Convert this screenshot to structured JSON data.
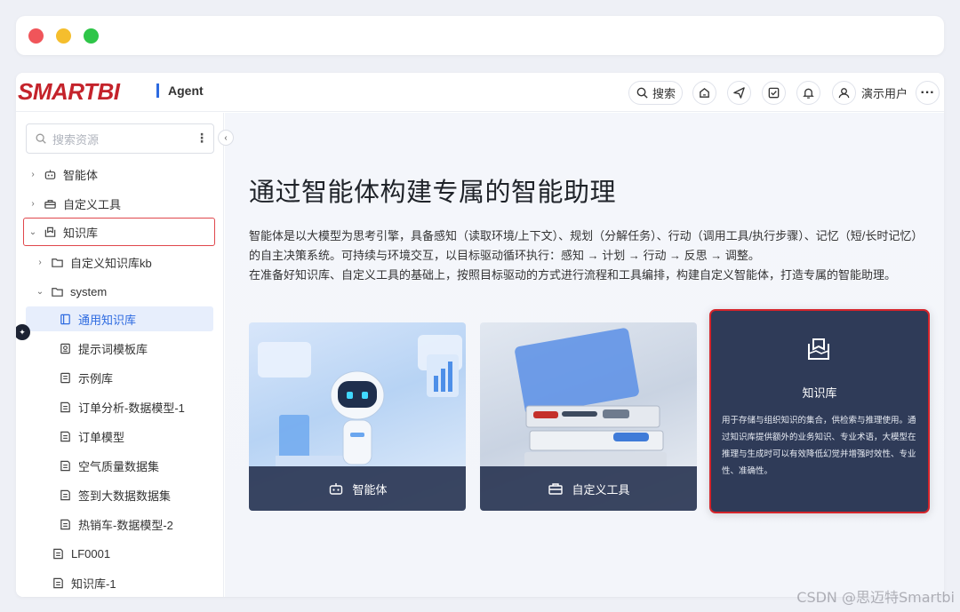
{
  "window_controls": [
    "close",
    "minimize",
    "maximize"
  ],
  "header": {
    "logo": "SMARTBI",
    "product": "Agent",
    "search_label": "搜索",
    "user_name": "演示用户",
    "more_label": "···"
  },
  "sidebar": {
    "search_placeholder": "搜索资源",
    "kebab": "⋮",
    "collapse": "‹",
    "tree": [
      {
        "label": "智能体",
        "arrow": "›"
      },
      {
        "label": "自定义工具",
        "arrow": "›"
      },
      {
        "label": "知识库",
        "arrow": "⌄"
      },
      {
        "label": "自定义知识库kb",
        "arrow": "›"
      },
      {
        "label": "system",
        "arrow": "⌄"
      },
      {
        "label": "通用知识库"
      },
      {
        "label": "提示词模板库"
      },
      {
        "label": "示例库"
      },
      {
        "label": "订单分析-数据模型-1"
      },
      {
        "label": "订单模型"
      },
      {
        "label": "空气质量数据集"
      },
      {
        "label": "签到大数据数据集"
      },
      {
        "label": "热销车-数据模型-2"
      },
      {
        "label": "LF0001"
      },
      {
        "label": "知识库-1"
      }
    ]
  },
  "main": {
    "title": "通过智能体构建专属的智能助理",
    "desc_line1": "智能体是以大模型为思考引擎，具备感知（读取环境/上下文）、规划（分解任务）、行动（调用工具/执行步骤）、记忆（短/长时记忆）的自主决策系统。可持续与环境交互，以目标驱动循环执行：感知 → 计划 → 行动 → 反思 → 调整。",
    "desc_line2": "在准备好知识库、自定义工具的基础上，按照目标驱动的方式进行流程和工具编排，构建自定义智能体，打造专属的智能助理。",
    "cards": [
      {
        "label": "智能体"
      },
      {
        "label": "自定义工具"
      },
      {
        "label": "知识库",
        "desc": "用于存储与组织知识的集合，供检索与推理使用。通过知识库提供额外的业务知识、专业术语，大模型在推理与生成时可以有效降低幻觉并增强时效性、专业性、准确性。"
      }
    ]
  },
  "watermark": "CSDN @思迈特Smartbi"
}
